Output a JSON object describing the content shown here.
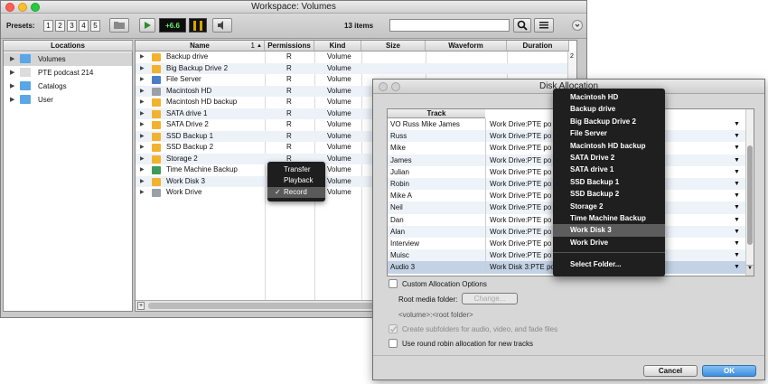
{
  "workspace": {
    "title": "Workspace: Volumes",
    "presets_label": "Presets:",
    "presets": [
      "1",
      "2",
      "3",
      "4",
      "5"
    ],
    "gain": "+6.6",
    "items_count": "13 items",
    "locations_header": "Locations",
    "locations": [
      {
        "label": "Volumes",
        "selected": true
      },
      {
        "label": "PTE podcast 214",
        "selected": false
      },
      {
        "label": "Catalogs",
        "selected": false
      },
      {
        "label": "User",
        "selected": false
      }
    ],
    "columns": {
      "name": "Name",
      "sort": "1",
      "permissions": "Permissions",
      "kind": "Kind",
      "size": "Size",
      "waveform": "Waveform",
      "duration": "Duration"
    },
    "scroll_indicator": "2",
    "files": [
      {
        "name": "Backup drive",
        "perm": "R",
        "kind": "Volume",
        "color": "#f2b230"
      },
      {
        "name": "Big Backup Drive 2",
        "perm": "R",
        "kind": "Volume",
        "color": "#f2b230"
      },
      {
        "name": "File Server",
        "perm": "R",
        "kind": "Volume",
        "color": "#4a7ec8"
      },
      {
        "name": "Macintosh HD",
        "perm": "R",
        "kind": "Volume",
        "color": "#9aa0a6"
      },
      {
        "name": "Macintosh HD backup",
        "perm": "R",
        "kind": "Volume",
        "color": "#f2b230"
      },
      {
        "name": "SATA drive 1",
        "perm": "R",
        "kind": "Volume",
        "color": "#f2b230"
      },
      {
        "name": "SATA Drive 2",
        "perm": "R",
        "kind": "Volume",
        "color": "#f2b230"
      },
      {
        "name": "SSD Backup 1",
        "perm": "R",
        "kind": "Volume",
        "color": "#f2b230"
      },
      {
        "name": "SSD Backup 2",
        "perm": "R",
        "kind": "Volume",
        "color": "#f2b230"
      },
      {
        "name": "Storage 2",
        "perm": "R",
        "kind": "Volume",
        "color": "#f2b230"
      },
      {
        "name": "Time Machine Backup",
        "perm": "R",
        "kind": "Volume",
        "color": "#3c9a5a"
      },
      {
        "name": "Work Disk 3",
        "perm": "R",
        "kind": "Volume",
        "color": "#f2b230"
      },
      {
        "name": "Work Drive",
        "perm": "R",
        "kind": "Volume",
        "color": "#9aa0a6"
      }
    ],
    "context_menu": {
      "items": [
        {
          "label": "Transfer",
          "checked": false
        },
        {
          "label": "Playback",
          "checked": false
        },
        {
          "label": "Record",
          "checked": true
        }
      ],
      "check": "✓"
    }
  },
  "disk_allocation": {
    "title": "Disk Allocation",
    "track_header": "Track",
    "rows": [
      {
        "track": "VO Russ Mike James",
        "location": "Work Drive:PTE po"
      },
      {
        "track": "Russ",
        "location": "Work Drive:PTE po"
      },
      {
        "track": "Mike",
        "location": "Work Drive:PTE po"
      },
      {
        "track": "James",
        "location": "Work Drive:PTE po"
      },
      {
        "track": "Julian",
        "location": "Work Drive:PTE po"
      },
      {
        "track": "Robin",
        "location": "Work Drive:PTE po"
      },
      {
        "track": "Mike A",
        "location": "Work Drive:PTE po"
      },
      {
        "track": "Neil",
        "location": "Work Drive:PTE po"
      },
      {
        "track": "Dan",
        "location": "Work Drive:PTE po"
      },
      {
        "track": "Alan",
        "location": "Work Drive:PTE po"
      },
      {
        "track": "Interview",
        "location": "Work Drive:PTE po"
      },
      {
        "track": "Muisc",
        "location": "Work Drive:PTE po"
      },
      {
        "track": "Audio 3",
        "location": "Work Disk 3:PTE po"
      }
    ],
    "dropdown": {
      "items": [
        "Macintosh HD",
        "Backup drive",
        "Big Backup Drive 2",
        "File Server",
        "Macintosh HD backup",
        "SATA Drive 2",
        "SATA drive 1",
        "SSD Backup 1",
        "SSD Backup 2",
        "Storage 2",
        "Time Machine Backup",
        "Work Disk 3",
        "Work Drive"
      ],
      "highlighted": "Work Disk 3",
      "select_folder": "Select Folder..."
    },
    "custom_allocation": "Custom Allocation Options",
    "root_media_label": "Root media folder:",
    "change_button": "Change...",
    "path_template": "<volume>:<root folder>",
    "create_subfolders": "Create subfolders for audio, video, and fade files",
    "round_robin": "Use round robin allocation for new tracks",
    "cancel": "Cancel",
    "ok": "OK"
  }
}
